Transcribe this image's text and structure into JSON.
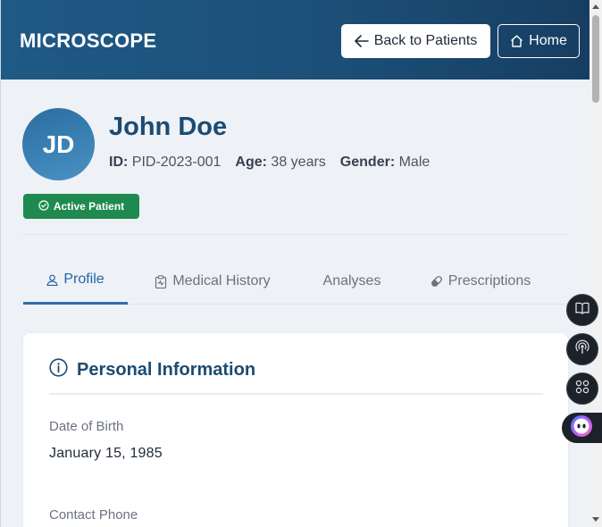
{
  "header": {
    "brand": "MICROSCOPE",
    "back_button": "Back to Patients",
    "home_button": "Home",
    "colors": {
      "bar_start": "#1e5a85",
      "bar_end": "#173e62"
    }
  },
  "patient": {
    "initials": "JD",
    "name": "John Doe",
    "id_label": "ID:",
    "id_value": "PID-2023-001",
    "age_label": "Age:",
    "age_value": "38 years",
    "gender_label": "Gender:",
    "gender_value": "Male",
    "status_badge": "Active Patient",
    "status_color": "#1f8a4f"
  },
  "tabs": [
    {
      "label": "Profile",
      "icon": "user-icon",
      "active": true
    },
    {
      "label": "Medical History",
      "icon": "clipboard-icon",
      "active": false
    },
    {
      "label": "Analyses",
      "icon": "flask-icon",
      "active": false
    },
    {
      "label": "Prescriptions",
      "icon": "pill-icon",
      "active": false
    }
  ],
  "personal_info": {
    "title": "Personal Information",
    "fields": [
      {
        "label": "Date of Birth",
        "value": "January 15, 1985"
      },
      {
        "label": "Contact Phone",
        "value": ""
      }
    ]
  },
  "side_toolbar": [
    {
      "icon": "book-icon"
    },
    {
      "icon": "broadcast-icon"
    },
    {
      "icon": "apps-grid-icon"
    },
    {
      "icon": "assistant-bot-icon"
    }
  ]
}
